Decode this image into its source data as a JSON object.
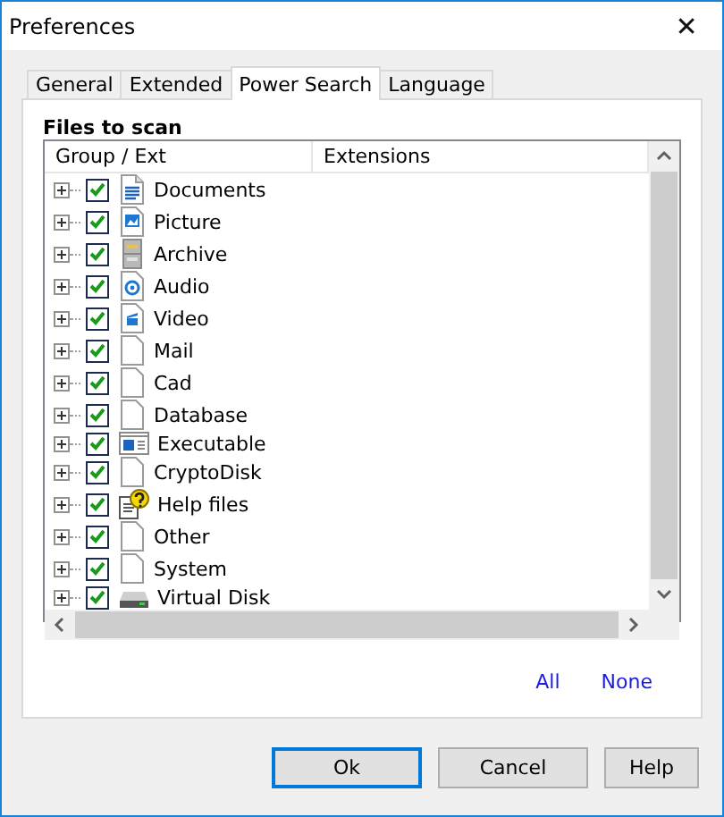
{
  "window": {
    "title": "Preferences",
    "close": "✕"
  },
  "tabs": [
    {
      "label": "General",
      "selected": false
    },
    {
      "label": "Extended",
      "selected": false
    },
    {
      "label": "Power Search",
      "selected": true
    },
    {
      "label": "Language",
      "selected": false
    }
  ],
  "section_title": "Files to scan",
  "table": {
    "columns": [
      "Group / Ext",
      "Extensions"
    ],
    "rows": [
      {
        "name": "Documents",
        "kind": "document",
        "checked": true,
        "expanded": false
      },
      {
        "name": "Picture",
        "kind": "picture",
        "checked": true,
        "expanded": false
      },
      {
        "name": "Archive",
        "kind": "archive",
        "checked": true,
        "expanded": false
      },
      {
        "name": "Audio",
        "kind": "audio",
        "checked": true,
        "expanded": false
      },
      {
        "name": "Video",
        "kind": "video",
        "checked": true,
        "expanded": false
      },
      {
        "name": "Mail",
        "kind": "blank",
        "checked": true,
        "expanded": false
      },
      {
        "name": "Cad",
        "kind": "blank",
        "checked": true,
        "expanded": false
      },
      {
        "name": "Database",
        "kind": "blank",
        "checked": true,
        "expanded": false
      },
      {
        "name": "Executable",
        "kind": "executable",
        "checked": true,
        "expanded": false
      },
      {
        "name": "CryptoDisk",
        "kind": "blank",
        "checked": true,
        "expanded": false
      },
      {
        "name": "Help files",
        "kind": "help",
        "checked": true,
        "expanded": false
      },
      {
        "name": "Other",
        "kind": "blank",
        "checked": true,
        "expanded": false
      },
      {
        "name": "System",
        "kind": "blank",
        "checked": true,
        "expanded": false
      },
      {
        "name": "Virtual Disk",
        "kind": "disk",
        "checked": true,
        "expanded": false
      }
    ]
  },
  "links": [
    "All",
    "None"
  ],
  "buttons": [
    {
      "label": "Ok",
      "default": true
    },
    {
      "label": "Cancel",
      "default": false
    },
    {
      "label": "Help",
      "default": false
    }
  ]
}
